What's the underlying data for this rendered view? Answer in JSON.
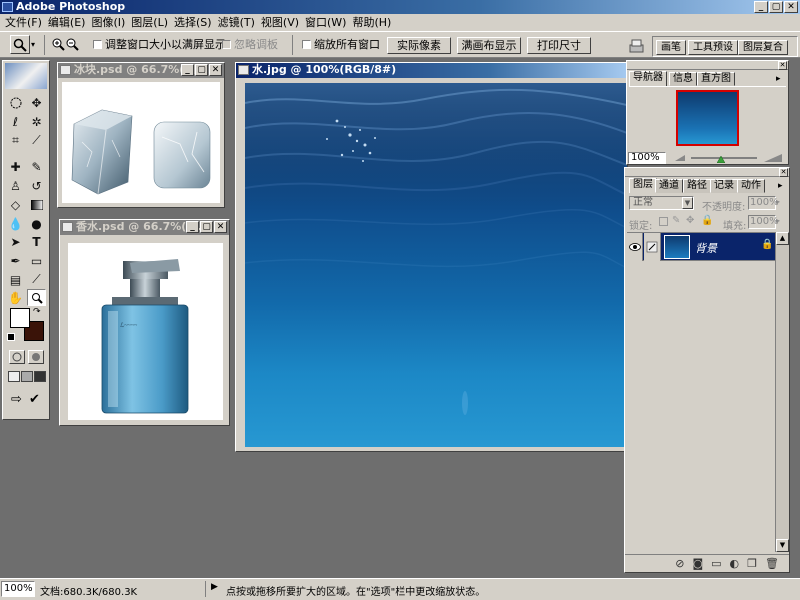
{
  "app_title": "Adobe Photoshop",
  "window_controls": {
    "minimize": "_",
    "maximize": "▢",
    "close": "✕"
  },
  "menu": [
    "文件(F)",
    "编辑(E)",
    "图像(I)",
    "图层(L)",
    "选择(S)",
    "滤镜(T)",
    "视图(V)",
    "窗口(W)",
    "帮助(H)"
  ],
  "options": {
    "resize_windows": "调整窗口大小以满屏显示",
    "ignore_palettes": "忽略调板",
    "zoom_all": "缩放所有窗口",
    "actual_pixels": "实际像素",
    "fit_on_screen": "满画布显示",
    "print_size": "打印尺寸"
  },
  "palette_well": [
    "画笔",
    "工具预设",
    "图层复合"
  ],
  "documents": {
    "ice": {
      "title": "冰块.psd @ 66.7%(图..."
    },
    "perfume": {
      "title": "香水.psd @ 66.7%(图..."
    },
    "water": {
      "title": "水.jpg @ 100%(RGB/8#)"
    }
  },
  "navigator": {
    "tabs": [
      "导航器",
      "信息",
      "直方图"
    ],
    "zoom": "100%",
    "slider_value": 0.45
  },
  "layers": {
    "tabs": [
      "图层",
      "通道",
      "路径",
      "记录",
      "动作"
    ],
    "blend_mode": "正常",
    "opacity_label": "不透明度:",
    "opacity_value": "100%",
    "lock_label": "锁定:",
    "fill_label": "填充:",
    "fill_value": "100%",
    "items": [
      {
        "name": "背景",
        "visible": true,
        "selected": true
      }
    ]
  },
  "status": {
    "zoom": "100%",
    "doc_size": "文档:680.3K/680.3K",
    "hint": "点按或拖移所要扩大的区域。在\"选项\"栏中更改缩放状态。"
  },
  "colors": {
    "title_active": "#0a246a",
    "chrome": "#d4d0c8",
    "workspace": "#6e6e6e",
    "layer_selected": "#0a246a"
  }
}
